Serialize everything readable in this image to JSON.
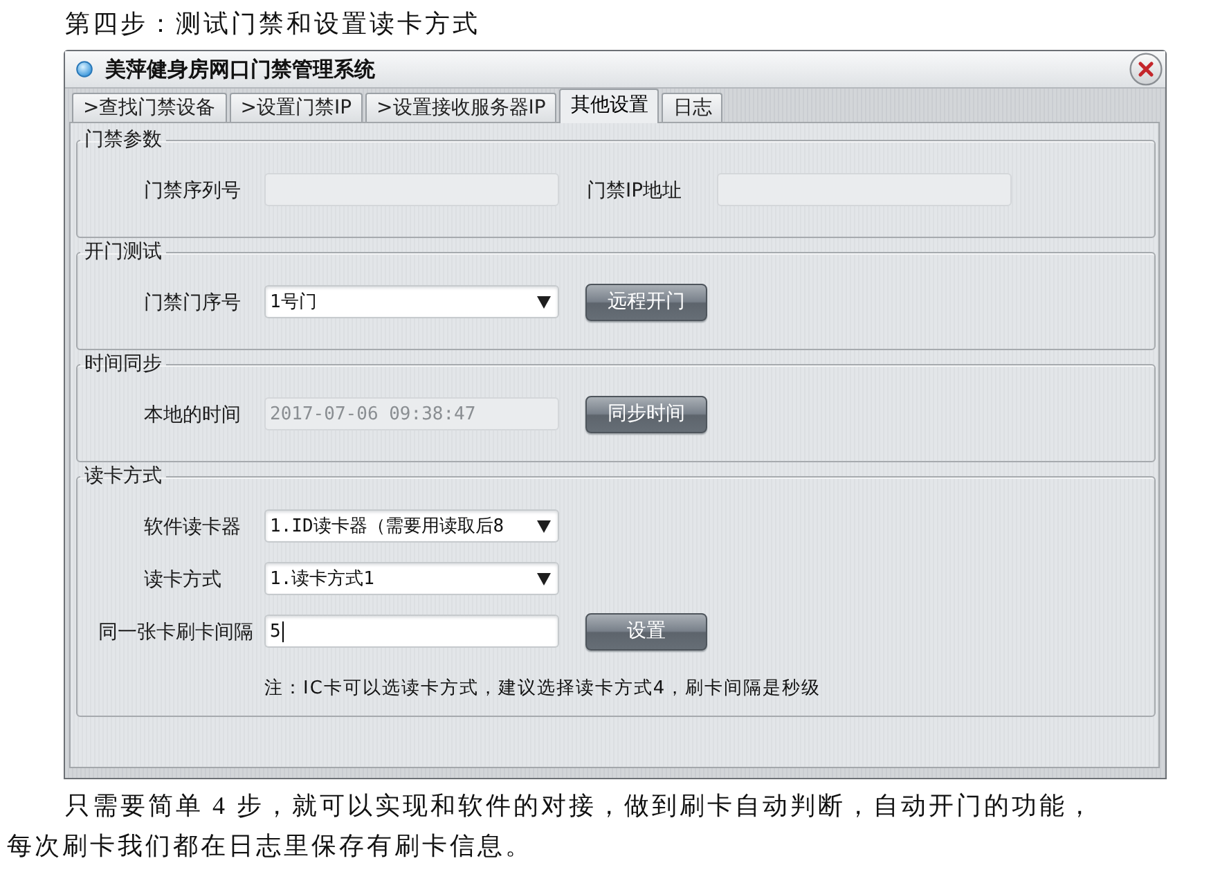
{
  "heading": "第四步：测试门禁和设置读卡方式",
  "window": {
    "title": "美萍健身房网口门禁管理系统"
  },
  "tabs": [
    {
      "label": ">查找门禁设备",
      "selected": false
    },
    {
      "label": ">设置门禁IP",
      "selected": false
    },
    {
      "label": ">设置接收服务器IP",
      "selected": false
    },
    {
      "label": "其他设置",
      "selected": true
    },
    {
      "label": "日志",
      "selected": false
    }
  ],
  "groups": [
    {
      "legend": "门禁参数",
      "rows": [
        {
          "fields": [
            {
              "label": "门禁序列号",
              "kind": "input",
              "disabled": true,
              "focused": false
            },
            {
              "label": "门禁IP地址",
              "kind": "input",
              "disabled": true,
              "focused": false
            }
          ]
        }
      ]
    },
    {
      "legend": "开门测试",
      "rows": [
        {
          "fields": [
            {
              "label": "门禁门序号",
              "kind": "select",
              "value": "1号门",
              "disabled": false,
              "focused": false
            }
          ],
          "button": "远程开门"
        }
      ]
    },
    {
      "legend": "时间同步",
      "rows": [
        {
          "fields": [
            {
              "label": "本地的时间",
              "kind": "input",
              "value": "2017-07-06 09:38:47",
              "disabled": true,
              "focused": false
            }
          ],
          "button": "同步时间"
        }
      ]
    },
    {
      "legend": "读卡方式",
      "rows": [
        {
          "fields": [
            {
              "label": "软件读卡器",
              "kind": "select",
              "value": "1.ID读卡器（需要用读取后8",
              "disabled": false,
              "focused": false
            }
          ]
        },
        {
          "fields": [
            {
              "label": "读卡方式",
              "kind": "select",
              "value": "1.读卡方式1",
              "disabled": false,
              "focused": false
            }
          ]
        },
        {
          "fields": [
            {
              "label": "同一张卡刷卡间隔",
              "kind": "input",
              "value": "5",
              "disabled": false,
              "focused": true
            }
          ],
          "button": "设置"
        }
      ],
      "note": "注：IC卡可以选读卡方式，建议选择读卡方式4，刷卡间隔是秒级"
    }
  ],
  "paragraph": "只需要简单 4 步，就可以实现和软件的对接，做到刷卡自动判断，自动开门的功能，每次刷卡我们都在日志里保存有刷卡信息。"
}
